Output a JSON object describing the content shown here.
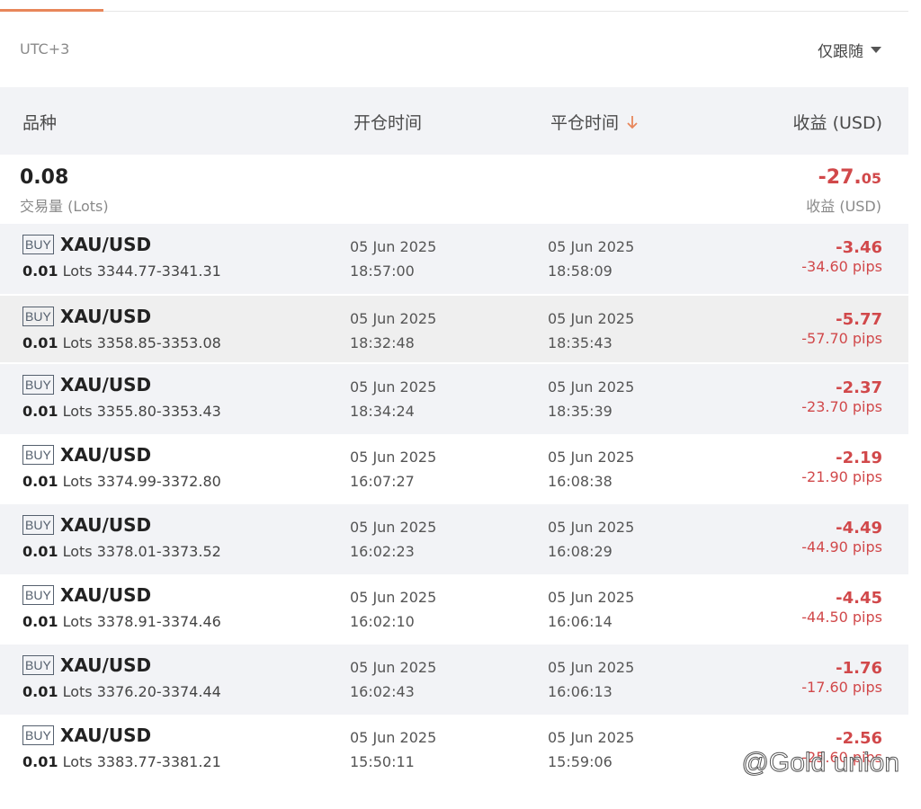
{
  "header": {
    "timezone": "UTC+3",
    "filter_label": "仅跟随"
  },
  "columns": {
    "symbol": "品种",
    "open_time": "开仓时间",
    "close_time": "平仓时间",
    "profit": "收益 (USD)"
  },
  "summary": {
    "volume": "0.08",
    "volume_label": "交易量 (Lots)",
    "profit_int": "-27.",
    "profit_dec": "05",
    "profit_label": "收益 (USD)"
  },
  "trades": [
    {
      "side": "BUY",
      "symbol": "XAU/USD",
      "qty": "0.01",
      "lots_word": "Lots",
      "range": "3344.77-3341.31",
      "open_date": "05 Jun 2025",
      "open_time": "18:57:00",
      "close_date": "05 Jun 2025",
      "close_time": "18:58:09",
      "profit": "-3.46",
      "pips": "-34.60 pips"
    },
    {
      "side": "BUY",
      "symbol": "XAU/USD",
      "qty": "0.01",
      "lots_word": "Lots",
      "range": "3358.85-3353.08",
      "open_date": "05 Jun 2025",
      "open_time": "18:32:48",
      "close_date": "05 Jun 2025",
      "close_time": "18:35:43",
      "profit": "-5.77",
      "pips": "-57.70 pips"
    },
    {
      "side": "BUY",
      "symbol": "XAU/USD",
      "qty": "0.01",
      "lots_word": "Lots",
      "range": "3355.80-3353.43",
      "open_date": "05 Jun 2025",
      "open_time": "18:34:24",
      "close_date": "05 Jun 2025",
      "close_time": "18:35:39",
      "profit": "-2.37",
      "pips": "-23.70 pips"
    },
    {
      "side": "BUY",
      "symbol": "XAU/USD",
      "qty": "0.01",
      "lots_word": "Lots",
      "range": "3374.99-3372.80",
      "open_date": "05 Jun 2025",
      "open_time": "16:07:27",
      "close_date": "05 Jun 2025",
      "close_time": "16:08:38",
      "profit": "-2.19",
      "pips": "-21.90 pips"
    },
    {
      "side": "BUY",
      "symbol": "XAU/USD",
      "qty": "0.01",
      "lots_word": "Lots",
      "range": "3378.01-3373.52",
      "open_date": "05 Jun 2025",
      "open_time": "16:02:23",
      "close_date": "05 Jun 2025",
      "close_time": "16:08:29",
      "profit": "-4.49",
      "pips": "-44.90 pips"
    },
    {
      "side": "BUY",
      "symbol": "XAU/USD",
      "qty": "0.01",
      "lots_word": "Lots",
      "range": "3378.91-3374.46",
      "open_date": "05 Jun 2025",
      "open_time": "16:02:10",
      "close_date": "05 Jun 2025",
      "close_time": "16:06:14",
      "profit": "-4.45",
      "pips": "-44.50 pips"
    },
    {
      "side": "BUY",
      "symbol": "XAU/USD",
      "qty": "0.01",
      "lots_word": "Lots",
      "range": "3376.20-3374.44",
      "open_date": "05 Jun 2025",
      "open_time": "16:02:43",
      "close_date": "05 Jun 2025",
      "close_time": "16:06:13",
      "profit": "-1.76",
      "pips": "-17.60 pips"
    },
    {
      "side": "BUY",
      "symbol": "XAU/USD",
      "qty": "0.01",
      "lots_word": "Lots",
      "range": "3383.77-3381.21",
      "open_date": "05 Jun 2025",
      "open_time": "15:50:11",
      "close_date": "05 Jun 2025",
      "close_time": "15:59:06",
      "profit": "-2.56",
      "pips": "-25.60 pips"
    }
  ],
  "watermark": "@Gold union",
  "colors": {
    "accent": "#e8865a",
    "loss": "#d1484a",
    "row_alt": "#f2f3f6"
  }
}
